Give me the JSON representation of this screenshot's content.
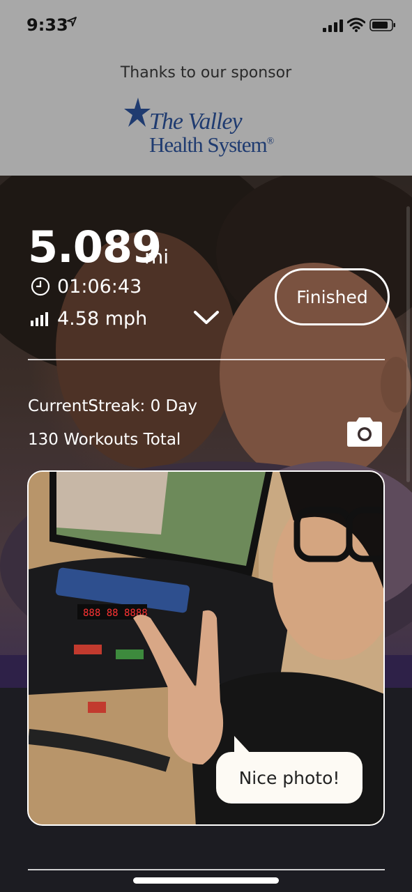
{
  "status_bar": {
    "time": "9:33",
    "icons": [
      "location-arrow-icon",
      "cellular-signal-icon",
      "wifi-icon",
      "battery-icon"
    ]
  },
  "sponsor": {
    "label": "Thanks to our sponsor",
    "logo_line1": "The Valley",
    "logo_line2": "Health System",
    "logo_mark": "®",
    "brand_color": "#1f3b70"
  },
  "workout": {
    "distance": "5.089",
    "distance_unit": "mi",
    "duration": "01:06:43",
    "speed": "4.58 mph",
    "finished_label": "Finished",
    "current_streak": "CurrentStreak: 0 Day",
    "workouts_total": "130 Workouts Total"
  },
  "photo": {
    "caption_bubble": "Nice photo!",
    "treadmill_display": "888 88 8888"
  },
  "colors": {
    "sponsor_bg": "#a8a8a8",
    "page_bg": "#1b1b22",
    "accent_purple": "#2e2148"
  }
}
